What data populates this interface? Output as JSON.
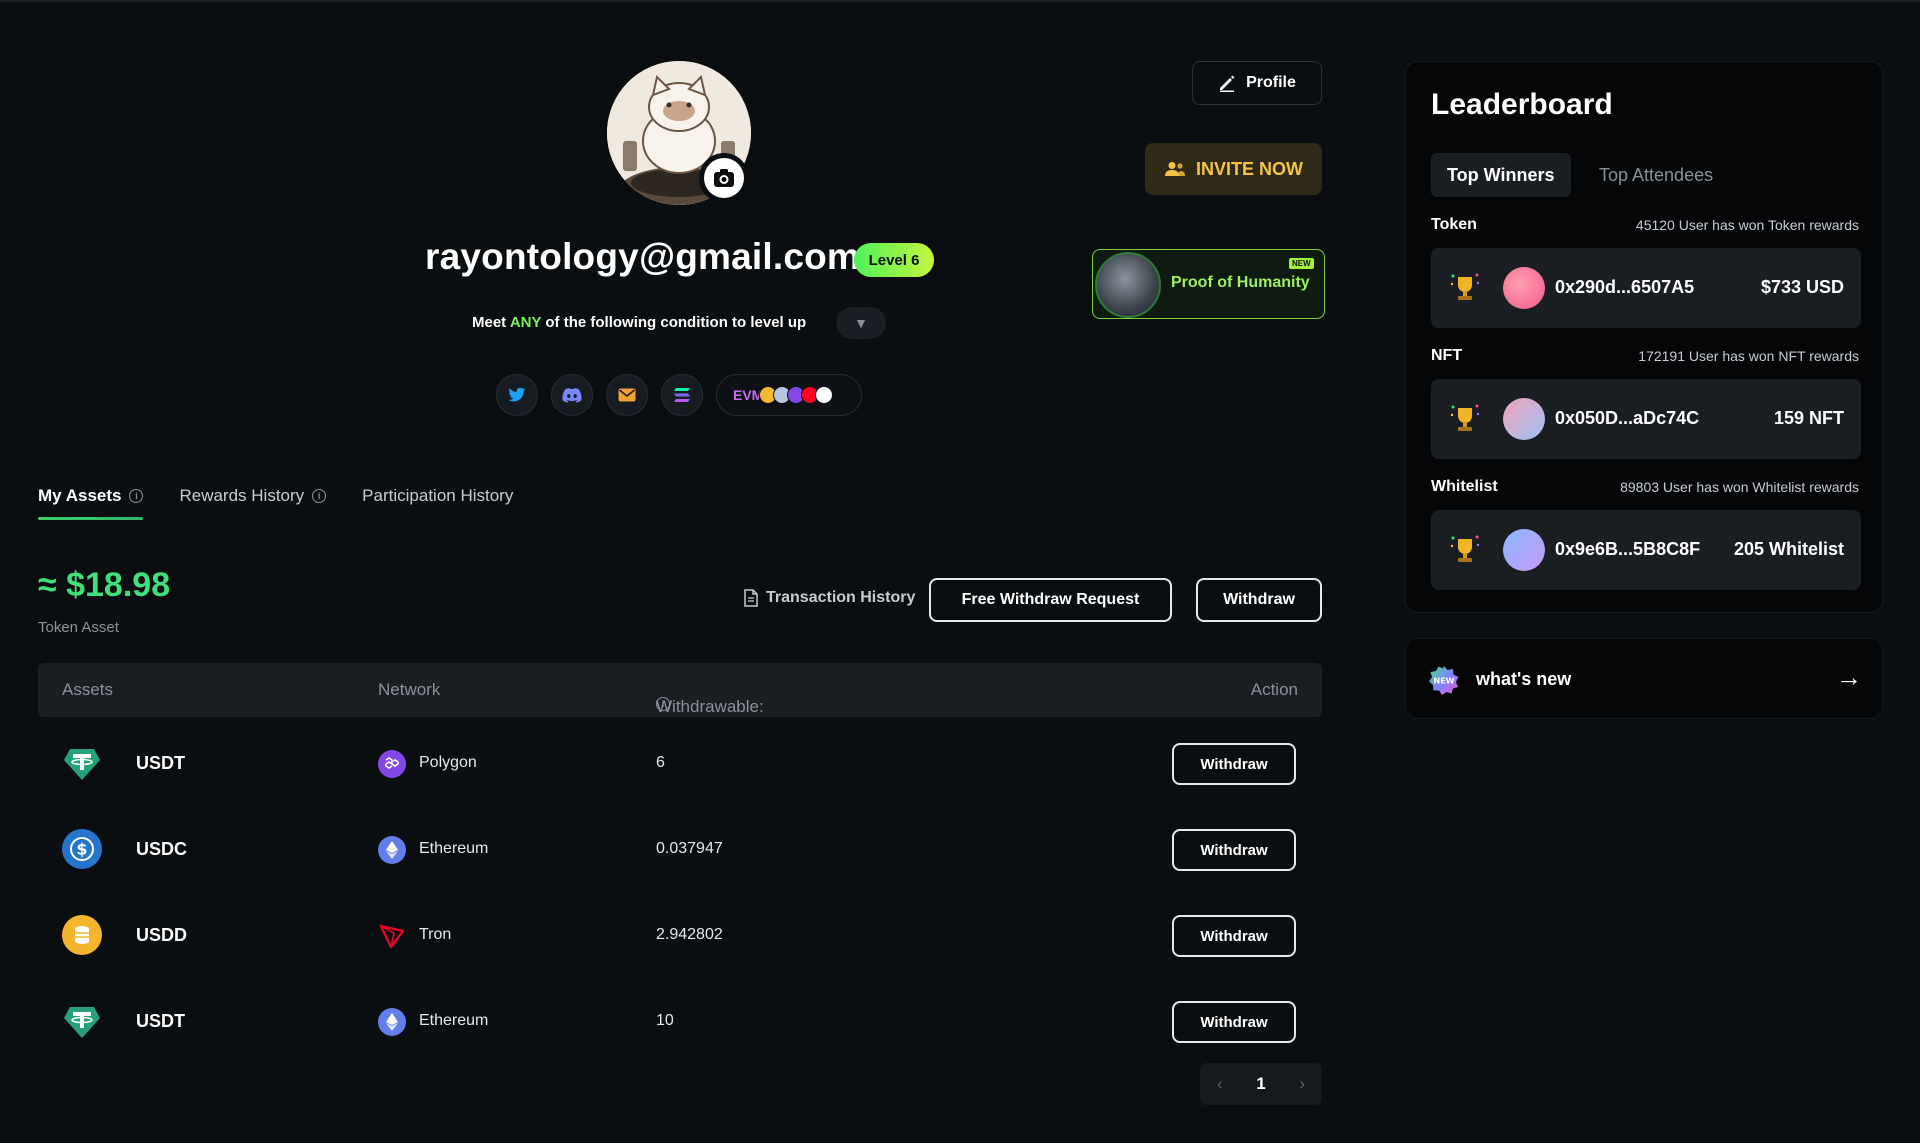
{
  "profile": {
    "button_label": "Profile",
    "invite_label": "INVITE NOW",
    "proof_of_humanity_label": "Proof of Humanity",
    "proof_of_humanity_badge": "NEW",
    "email": "rayontology@gmail.com",
    "level": "Level 6",
    "levelup_prefix": "Meet",
    "levelup_highlight": "ANY",
    "levelup_suffix": "of the following condition to level up",
    "social_icons": [
      "twitter-icon",
      "discord-icon",
      "email-icon",
      "solana-icon"
    ],
    "evm_label": "EVM"
  },
  "tabs": [
    {
      "label": "My Assets",
      "active": true,
      "info": true
    },
    {
      "label": "Rewards History",
      "active": false,
      "info": true
    },
    {
      "label": "Participation History",
      "active": false,
      "info": false
    }
  ],
  "balance": {
    "value": "≈ $18.98",
    "label": "Token Asset",
    "tx_history_label": "Transaction History",
    "free_withdraw_label": "Free Withdraw Request",
    "withdraw_label": "Withdraw"
  },
  "assets_table": {
    "headers": [
      "Assets",
      "Network",
      "Withdrawable:",
      "Action"
    ],
    "rows": [
      {
        "asset": "USDT",
        "asset_icon": "tether-icon",
        "network": "Polygon",
        "network_icon": "polygon-icon",
        "amount": "6",
        "action": "Withdraw"
      },
      {
        "asset": "USDC",
        "asset_icon": "usdc-icon",
        "network": "Ethereum",
        "network_icon": "ethereum-icon",
        "amount": "0.037947",
        "action": "Withdraw"
      },
      {
        "asset": "USDD",
        "asset_icon": "usdd-icon",
        "network": "Tron",
        "network_icon": "tron-icon",
        "amount": "2.942802",
        "action": "Withdraw"
      },
      {
        "asset": "USDT",
        "asset_icon": "tether-icon",
        "network": "Ethereum",
        "network_icon": "ethereum-icon",
        "amount": "10",
        "action": "Withdraw"
      }
    ],
    "pagination": {
      "current_page": "1"
    }
  },
  "leaderboard": {
    "title": "Leaderboard",
    "tabs": [
      "Top Winners",
      "Top Attendees"
    ],
    "sections": [
      {
        "title": "Token",
        "description": "45120 User has won Token rewards",
        "address": "0x290d...6507A5",
        "reward": "$733 USD"
      },
      {
        "title": "NFT",
        "description": "172191 User has won NFT rewards",
        "address": "0x050D...aDc74C",
        "reward": "159 NFT"
      },
      {
        "title": "Whitelist",
        "description": "89803 User has won Whitelist rewards",
        "address": "0x9e6B...5B8C8F",
        "reward": "205 Whitelist"
      }
    ]
  },
  "whats_new": {
    "label": "what's new",
    "badge": "NEW"
  },
  "colors": {
    "background": "#0b0e11",
    "accent_green": "#3fe07a",
    "invite_gold": "#f6c344",
    "panel": "#1a1e23"
  }
}
